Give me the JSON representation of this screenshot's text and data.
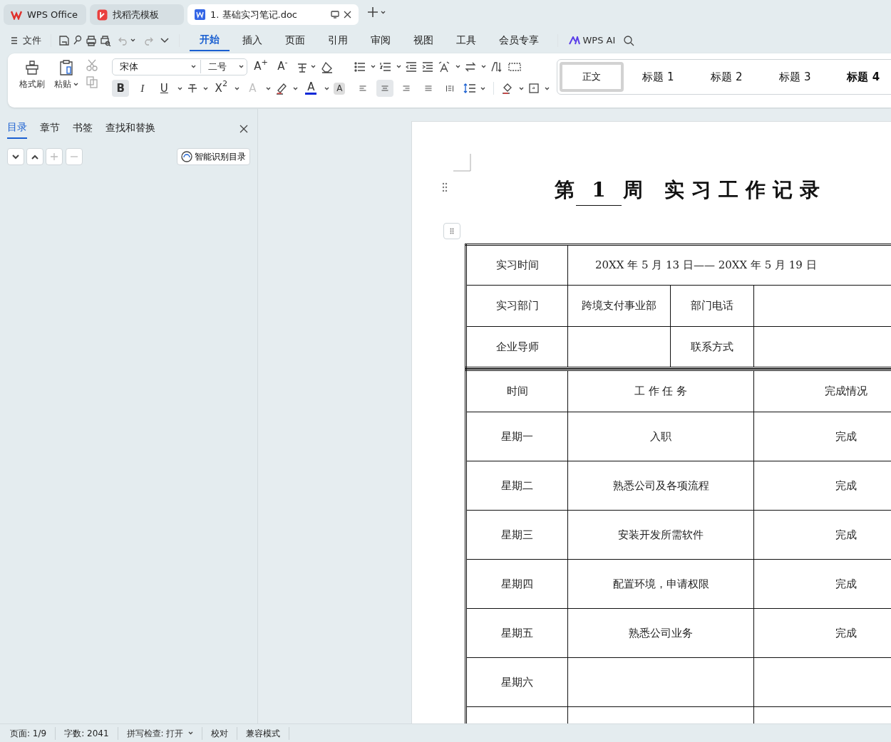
{
  "app_tabs": [
    {
      "label": "WPS Office",
      "kind": "home",
      "selected": false
    },
    {
      "label": "找稻壳模板",
      "kind": "template",
      "selected": false
    },
    {
      "label": "1. 基础实习笔记.doc",
      "kind": "doc",
      "selected": true
    }
  ],
  "menu": {
    "file": "文件",
    "tabs": [
      {
        "label": "开始",
        "selected": true
      },
      {
        "label": "插入",
        "selected": false
      },
      {
        "label": "页面",
        "selected": false
      },
      {
        "label": "引用",
        "selected": false
      },
      {
        "label": "审阅",
        "selected": false
      },
      {
        "label": "视图",
        "selected": false
      },
      {
        "label": "工具",
        "selected": false
      },
      {
        "label": "会员专享",
        "selected": false
      }
    ],
    "ai": "WPS AI"
  },
  "ribbon": {
    "format_painter": "格式刷",
    "paste": "粘贴",
    "font_name": "宋体",
    "font_size": "二号",
    "grow": "A$^{+}$",
    "shrink": "A$^{-}$",
    "format_buttons": [
      {
        "label": "B",
        "kind": "bold",
        "selected": true
      },
      {
        "label": "I",
        "kind": "italic",
        "selected": false
      },
      {
        "label": "U",
        "kind": "underline",
        "selected": false
      },
      {
        "label": "X$^{2}$",
        "kind": "super",
        "selected": false
      }
    ],
    "effect": "A",
    "font_color": {
      "label": "A",
      "color": "#0a28d8"
    },
    "shading": "A",
    "align": [
      {
        "kind": "left",
        "selected": false
      },
      {
        "kind": "center",
        "selected": true
      },
      {
        "kind": "right",
        "selected": false
      },
      {
        "kind": "justify",
        "selected": false
      },
      {
        "kind": "distribute",
        "selected": false
      }
    ],
    "styles": [
      {
        "label": "正文",
        "selected": true
      },
      {
        "label": "标题 1",
        "selected": false
      },
      {
        "label": "标题 2",
        "selected": false
      },
      {
        "label": "标题 3",
        "selected": false
      },
      {
        "label": "标题 4",
        "selected": false
      }
    ]
  },
  "sidebar": {
    "tabs": [
      {
        "label": "目录",
        "selected": true
      },
      {
        "label": "章节",
        "selected": false
      },
      {
        "label": "书签",
        "selected": false
      },
      {
        "label": "查找和替换",
        "selected": false
      }
    ],
    "smart_button": "智能识别目录"
  },
  "document": {
    "title_prefix": "第",
    "week": "1",
    "title_week": "周",
    "title": "实习工作记录",
    "info_rows": [
      {
        "cells": [
          "实习时间",
          "20XX 年 5 月 13 日—— 20XX 年 5 月 19 日"
        ]
      },
      {
        "cells": [
          "实习部门",
          "跨境支付事业部",
          "部门电话",
          null
        ]
      },
      {
        "cells": [
          "企业导师",
          null,
          "联系方式",
          null
        ]
      }
    ],
    "schedule_columns": [
      "时间",
      "工 作 任 务",
      "完成情况"
    ],
    "schedule_rows": [
      {
        "day": "星期一",
        "task": "入职",
        "status": "完成"
      },
      {
        "day": "星期二",
        "task": "熟悉公司及各项流程",
        "status": "完成"
      },
      {
        "day": "星期三",
        "task": "安装开发所需软件",
        "status": "完成"
      },
      {
        "day": "星期四",
        "task": "配置环境，申请权限",
        "status": "完成"
      },
      {
        "day": "星期五",
        "task": "熟悉公司业务",
        "status": "完成"
      },
      {
        "day": "星期六"
      },
      {}
    ]
  },
  "status_bar": [
    {
      "label": "页面: 1/9",
      "kind": "text"
    },
    {
      "label": "字数: 2041",
      "kind": "text"
    },
    {
      "label": "拼写检查: 打开",
      "kind": "dropdown"
    },
    {
      "label": "校对",
      "kind": "text"
    },
    {
      "label": "兼容模式",
      "kind": "text"
    }
  ]
}
